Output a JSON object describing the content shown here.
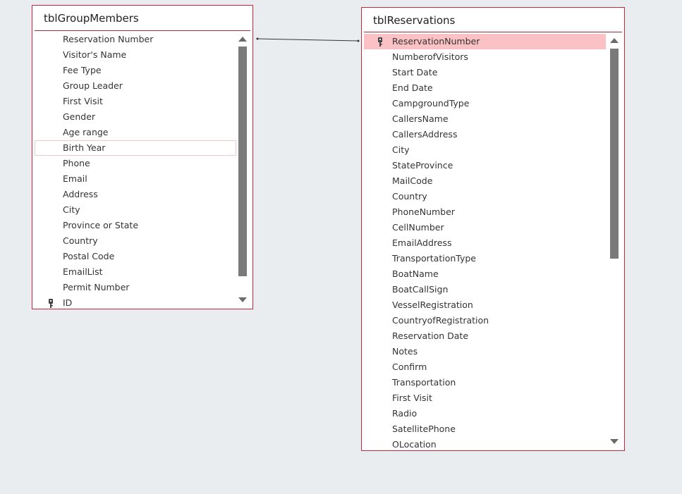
{
  "tables": [
    {
      "name": "tblGroupMembers",
      "fields": [
        "Reservation Number",
        "Visitor's Name",
        "Fee Type",
        "Group Leader",
        "First Visit",
        "Gender",
        "Age range",
        "Birth Year",
        "Phone",
        "Email",
        "Address",
        "City",
        "Province or State",
        "Country",
        "Postal Code",
        "EmailList",
        "Permit Number",
        "ID"
      ],
      "key_field": "ID",
      "focused_field": "Birth Year"
    },
    {
      "name": "tblReservations",
      "fields": [
        "ReservationNumber",
        "NumberofVisitors",
        "Start Date",
        "End Date",
        "CampgroundType",
        "CallersName",
        "CallersAddress",
        "City",
        "StateProvince",
        "MailCode",
        "Country",
        "PhoneNumber",
        "CellNumber",
        "EmailAddress",
        "TransportationType",
        "BoatName",
        "BoatCallSign",
        "VesselRegistration",
        "CountryofRegistration",
        "Reservation Date",
        "Notes",
        "Confirm",
        "Transportation",
        "First Visit",
        "Radio",
        "SatellitePhone",
        "OLocation"
      ],
      "key_field": "ReservationNumber",
      "selected_field": "ReservationNumber"
    }
  ],
  "relationship": {
    "from": "tblGroupMembers.Reservation Number",
    "to": "tblReservations.ReservationNumber"
  },
  "colors": {
    "border": "#c4283c",
    "selected": "#fcc1c4",
    "background": "#e9edf0"
  }
}
